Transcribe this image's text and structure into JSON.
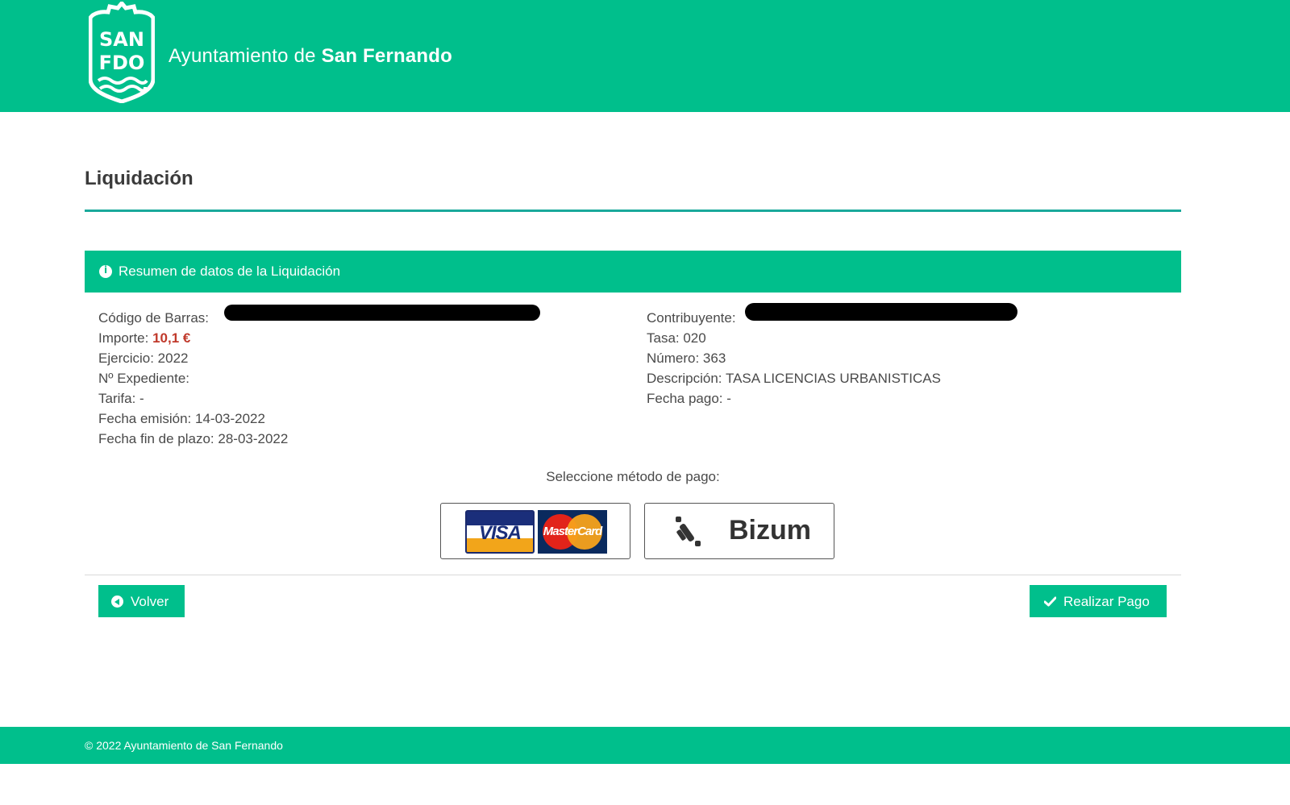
{
  "header": {
    "logo_text": "SAN FDO",
    "brand_prefix": "Ayuntamiento de ",
    "brand_name": "San Fernando",
    "bg_color": "#00bf8c"
  },
  "page_title": "Liquidación",
  "panel": {
    "icon": "info-icon",
    "title": "Resumen de datos de la Liquidación"
  },
  "details_left": {
    "barcode_label": "Código de Barras:",
    "amount_label": "Importe:",
    "amount_value": "10,1 €",
    "year": "Ejercicio: 2022",
    "file_number": "Nº Expediente:",
    "tariff": "Tarifa: -",
    "issue_date": "Fecha emisión: 14-03-2022",
    "due_date": "Fecha fin de plazo: 28-03-2022"
  },
  "details_right": {
    "taxpayer_label": "Contribuyente:",
    "fee": "Tasa: 020",
    "number": "Número: 363",
    "description": "Descripción: TASA LICENCIAS URBANISTICAS",
    "payment_date": "Fecha pago: -"
  },
  "payment": {
    "prompt": "Seleccione método de pago:",
    "card_logos": {
      "visa": "VISA",
      "mastercard": "MasterCard"
    },
    "bizum_label": "Bizum"
  },
  "actions": {
    "back_label": "Volver",
    "pay_label": "Realizar Pago"
  },
  "footer": {
    "copyright": "© 2022 Ayuntamiento de San Fernando"
  },
  "colors": {
    "accent": "#00bf8c",
    "amount": "#c0392b"
  }
}
